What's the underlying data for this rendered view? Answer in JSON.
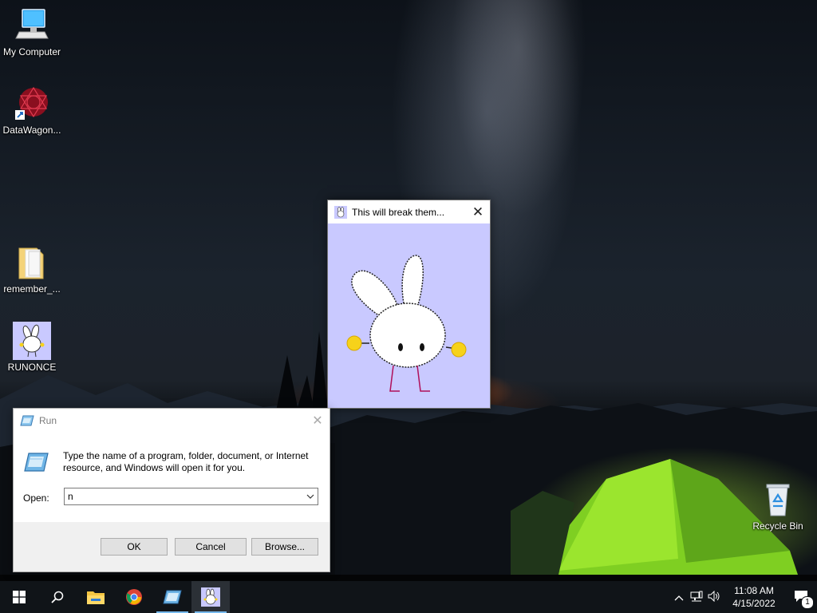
{
  "desktop": {
    "icons": [
      {
        "label": "My Computer"
      },
      {
        "label": "DataWagon..."
      },
      {
        "label": "remember_..."
      },
      {
        "label": "RUNONCE"
      },
      {
        "label": "Recycle Bin"
      }
    ]
  },
  "bunny_window": {
    "title": "This will break them...",
    "close_glyph": "✕"
  },
  "run_dialog": {
    "title": "Run",
    "close_glyph": "✕",
    "description": "Type the name of a program, folder, document, or Internet resource, and Windows will open it for you.",
    "open_label": "Open:",
    "open_value": "n",
    "ok_label": "OK",
    "cancel_label": "Cancel",
    "browse_label": "Browse..."
  },
  "taskbar": {
    "time": "11:08 AM",
    "date": "4/15/2022",
    "notification_count": "1"
  },
  "colors": {
    "bunny_bg": "#c9c9ff",
    "taskbar_bg": "#101418",
    "accent": "#76b9ed"
  }
}
